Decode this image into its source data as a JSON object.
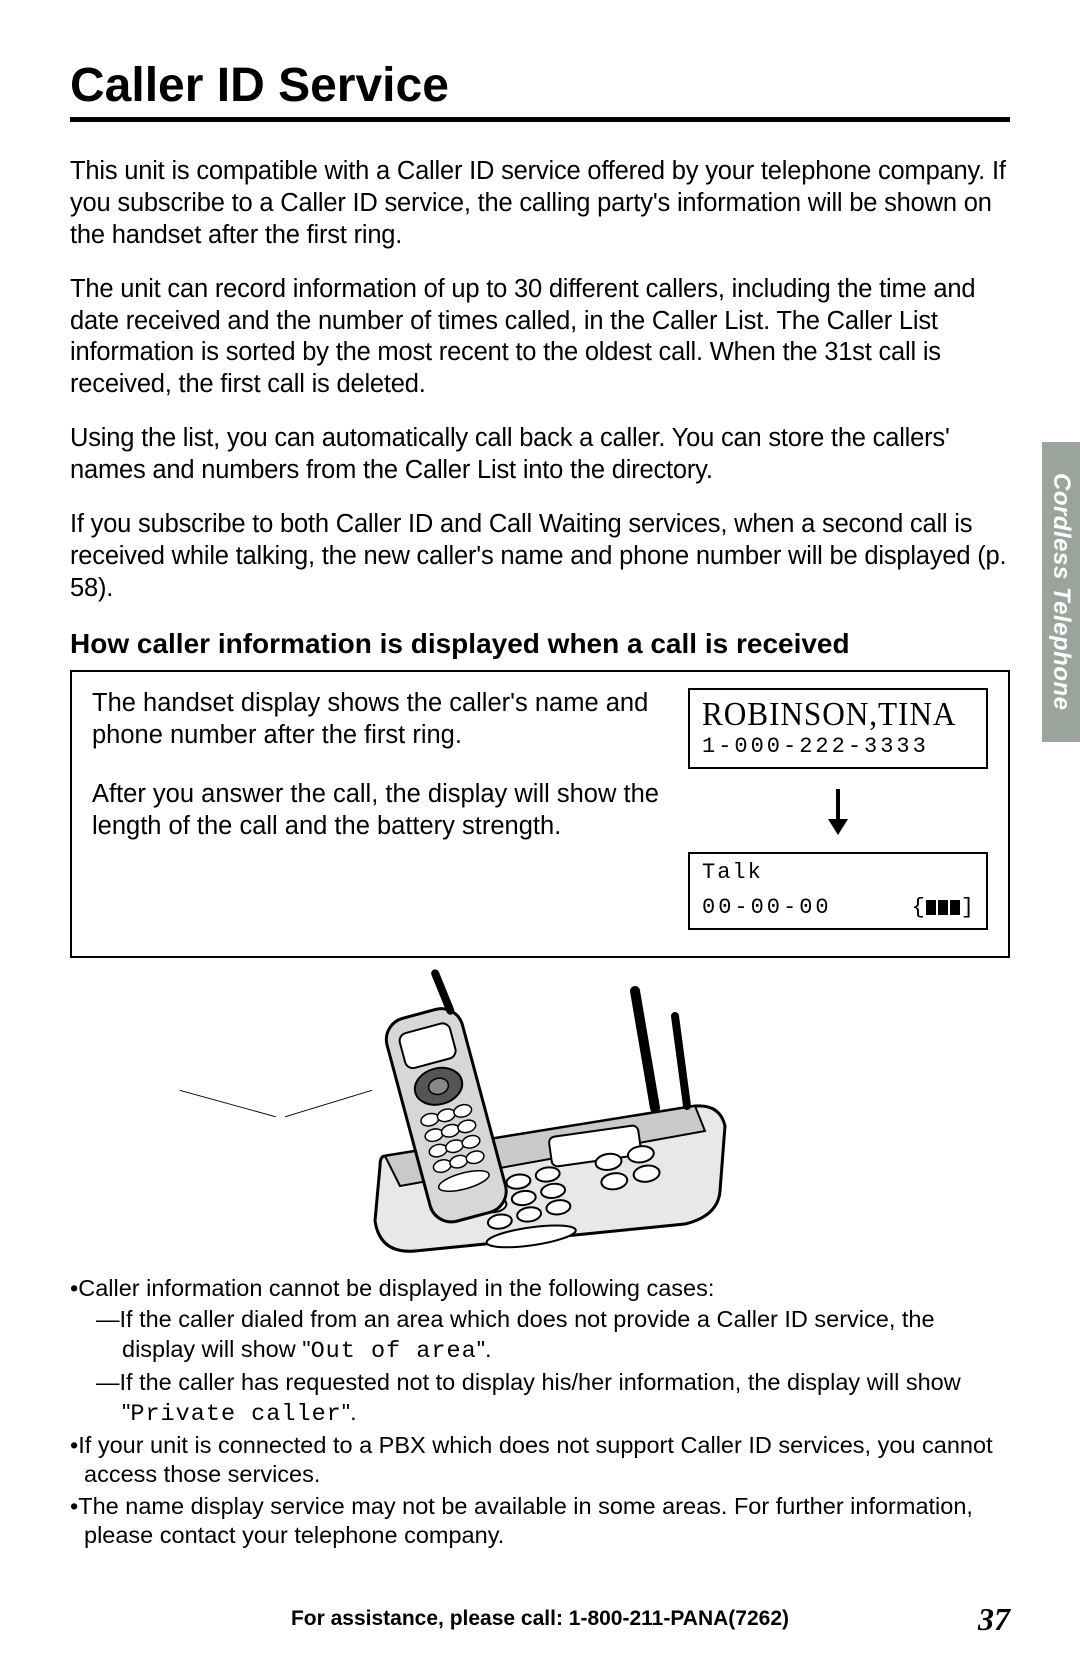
{
  "title": "Caller ID Service",
  "sideTab": "Cordless Telephone",
  "paragraphs": {
    "p1": "This unit is compatible with a Caller ID service offered by your telephone company. If you subscribe to a Caller ID service, the calling party's information will be shown on the handset after the first ring.",
    "p2": "The unit can record information of up to 30 different callers, including the time and date received and the number of times called, in the Caller List. The Caller List information is sorted by the most recent to the oldest call. When the 31st call is received, the first call is deleted.",
    "p3": "Using the list, you can automatically call back a caller. You can store the callers' names and numbers from the Caller List into the directory.",
    "p4": "If you subscribe to both Caller ID and Call Waiting services, when a second call is received while talking, the new caller's name and phone number will be displayed (p. 58)."
  },
  "subhead": "How caller information is displayed when a call is received",
  "callout": {
    "row1": "The handset display shows the caller's name and phone number after the first ring.",
    "row2": "After you answer the call, the display will show the length of the call and the battery strength."
  },
  "display": {
    "callerName": "ROBINSON,TINA",
    "callerNumber": "1-000-222-3333",
    "talkLabel": "Talk",
    "time": "00-00-00"
  },
  "notes": {
    "b1": "•Caller information cannot be displayed in the following cases:",
    "d1a": "—If the caller dialed from an area which does not provide a Caller ID service, the display will show \"",
    "d1code": "Out of area",
    "d1b": "\".",
    "d2a": "—If the caller has requested not to display his/her information, the display will show \"",
    "d2code": "Private caller",
    "d2b": "\".",
    "b2": "•If your unit is connected to a PBX which does not support Caller ID services, you cannot access those services.",
    "b3": "•The name display service may not be available in some areas. For further information, please contact your telephone company."
  },
  "footer": "For assistance, please call: 1-800-211-PANA(7262)",
  "pageNumber": "37"
}
